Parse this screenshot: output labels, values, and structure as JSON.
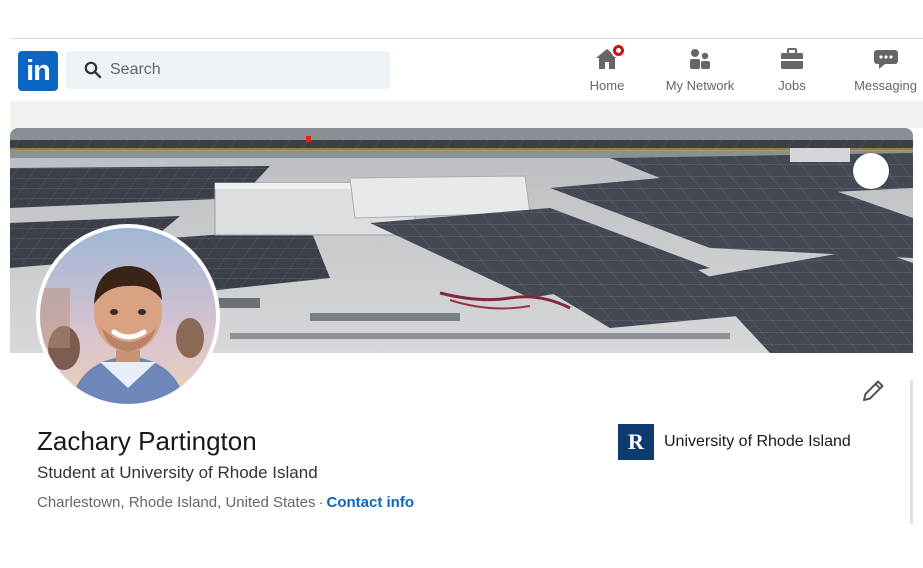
{
  "nav": {
    "logo_text": "in",
    "search_placeholder": "Search",
    "items": [
      {
        "label": "Home",
        "icon": "home-icon",
        "has_badge": true
      },
      {
        "label": "My Network",
        "icon": "people-icon"
      },
      {
        "label": "Jobs",
        "icon": "briefcase-icon"
      },
      {
        "label": "Messaging",
        "icon": "chat-icon"
      }
    ]
  },
  "profile": {
    "name": "Zachary Partington",
    "headline": "Student at University of Rhode Island",
    "location": "Charlestown, Rhode Island, United States",
    "separator": "·",
    "contact_label": "Contact info",
    "school": {
      "name": "University of Rhode Island",
      "logo_text": "R"
    }
  },
  "colors": {
    "brand": "#0a66c2",
    "badge": "#cc1016",
    "school_logo": "#0d3b70"
  }
}
